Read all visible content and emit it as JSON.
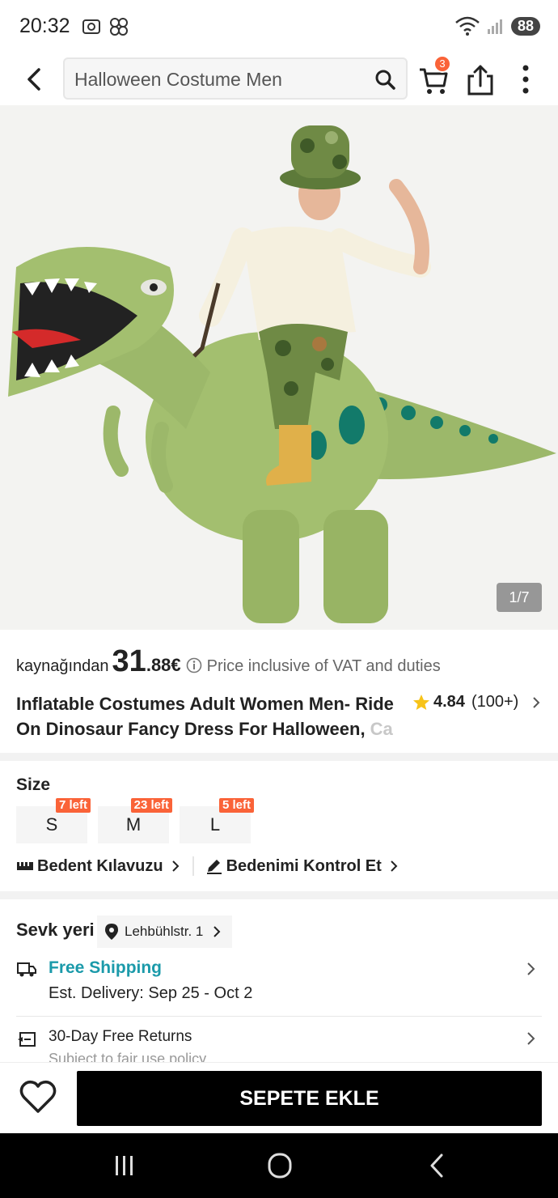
{
  "status_bar": {
    "time": "20:32",
    "battery": "88",
    "wifi_label": "6"
  },
  "search": {
    "query": "Halloween Costume Men"
  },
  "cart": {
    "badge_count": "3"
  },
  "gallery": {
    "counter": "1/7"
  },
  "price": {
    "prefix": "kaynağından",
    "integer": "31",
    "decimal": ".88€",
    "note": "Price inclusive of VAT and duties"
  },
  "product": {
    "title_main": "Inflatable Costumes Adult Women Men- Ride On Dinosaur Fancy Dress For Halloween, ",
    "title_faded": "Ca",
    "rating": "4.84",
    "rating_count": "(100+)"
  },
  "size": {
    "label": "Size",
    "options": [
      {
        "label": "S",
        "stock": "7 left"
      },
      {
        "label": "M",
        "stock": "23 left"
      },
      {
        "label": "L",
        "stock": "5 left"
      }
    ],
    "guide_label": "Bedent Kılavuzu",
    "check_label": "Bedenimi Kontrol Et"
  },
  "shipping": {
    "label": "Sevk yeri",
    "location": "Lehbühlstr. 1",
    "free_shipping": "Free Shipping",
    "est_delivery": "Est. Delivery: Sep 25 - Oct 2",
    "returns": "30-Day Free Returns",
    "returns_sub": "Subject to fair use policy"
  },
  "actions": {
    "add_to_cart": "SEPETE EKLE"
  },
  "colors": {
    "accent": "#fa6338",
    "teal": "#1b9aaa",
    "dino": "#9cb86a"
  }
}
